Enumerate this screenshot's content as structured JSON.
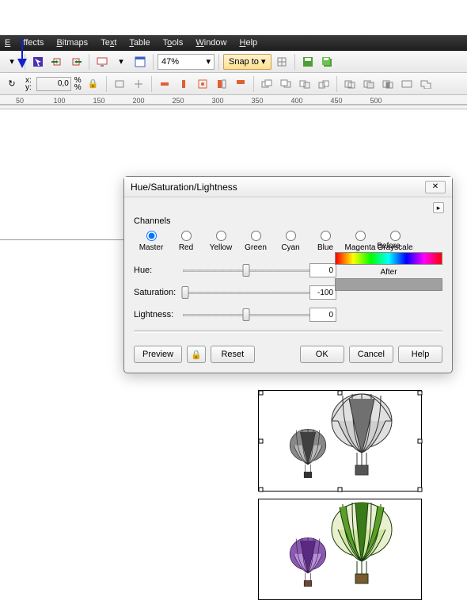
{
  "menu": {
    "effects": "Effects",
    "bitmaps": "Bitmaps",
    "text": "Text",
    "table": "Table",
    "tools": "Tools",
    "window": "Window",
    "help": "Help"
  },
  "toolbar1": {
    "zoom": "47%",
    "snap": "Snap to"
  },
  "toolbar2": {
    "x_label": "x:",
    "y_label": "y:",
    "x_value": "0,0",
    "pct": "%"
  },
  "ruler": {
    "ticks": [
      "50",
      "100",
      "150",
      "200",
      "250",
      "300",
      "350",
      "400",
      "450",
      "500"
    ]
  },
  "dialog": {
    "title": "Hue/Saturation/Lightness",
    "channels_label": "Channels",
    "channels": [
      "Master",
      "Red",
      "Yellow",
      "Green",
      "Cyan",
      "Blue",
      "Magenta",
      "Grayscale"
    ],
    "selected_channel": "Master",
    "hue_label": "Hue:",
    "saturation_label": "Saturation:",
    "lightness_label": "Lightness:",
    "hue_value": "0",
    "saturation_value": "-100",
    "lightness_value": "0",
    "before_label": "Before",
    "after_label": "After",
    "preview_btn": "Preview",
    "reset_btn": "Reset",
    "ok_btn": "OK",
    "cancel_btn": "Cancel",
    "help_btn": "Help"
  }
}
